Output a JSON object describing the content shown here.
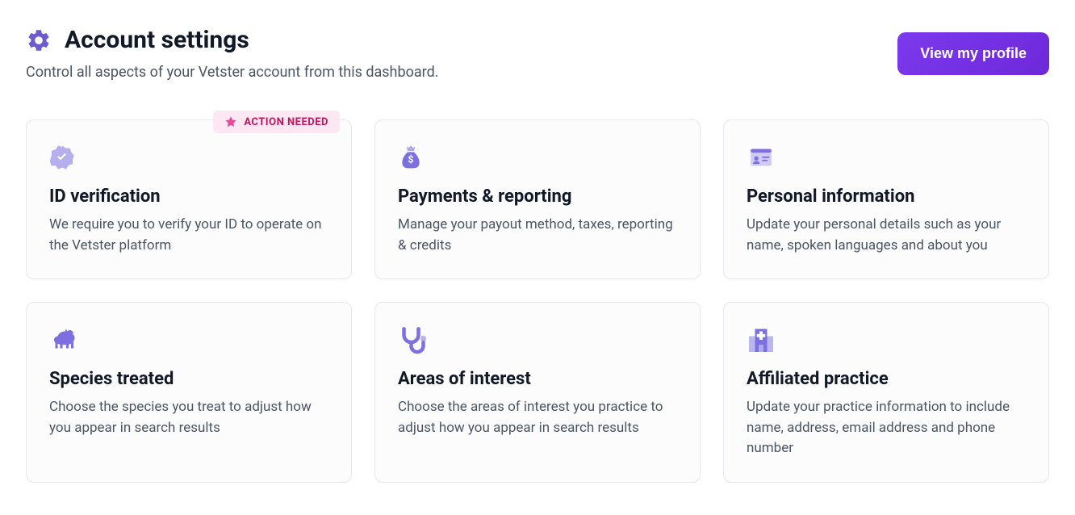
{
  "header": {
    "title": "Account settings",
    "subtitle": "Control all aspects of your Vetster account from this dashboard.",
    "view_profile_label": "View my profile"
  },
  "badge": {
    "label": "ACTION NEEDED"
  },
  "cards": [
    {
      "title": "ID verification",
      "desc": "We require you to verify your ID to operate on the Vetster platform"
    },
    {
      "title": "Payments & reporting",
      "desc": "Manage your payout method, taxes, reporting & credits"
    },
    {
      "title": "Personal information",
      "desc": "Update your personal details such as your name, spoken languages and about you"
    },
    {
      "title": "Species treated",
      "desc": "Choose the species you treat to adjust how you appear in search results"
    },
    {
      "title": "Areas of interest",
      "desc": "Choose the areas of interest you practice to adjust how you appear in search results"
    },
    {
      "title": "Affiliated practice",
      "desc": "Update your practice information to include name, address, email address and phone number"
    }
  ]
}
